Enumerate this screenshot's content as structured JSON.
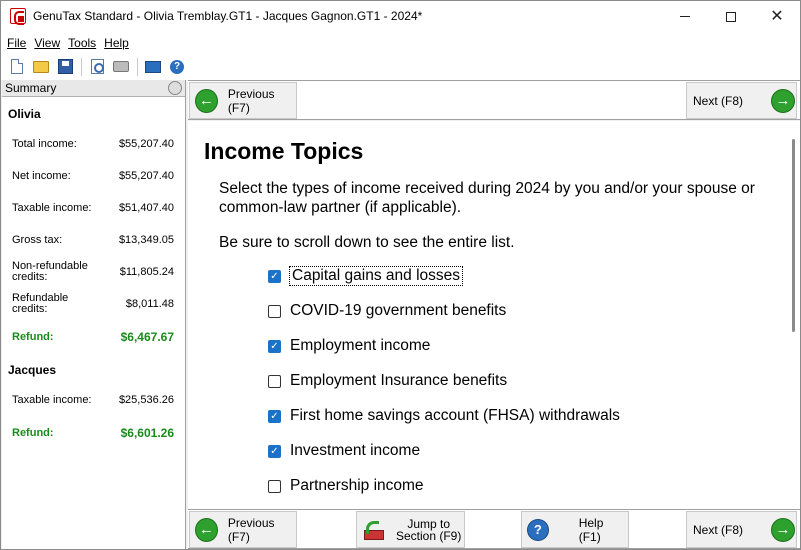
{
  "window": {
    "title": "GenuTax Standard - Olivia Tremblay.GT1 - Jacques Gagnon.GT1 - 2024*",
    "minimize": "—",
    "maximize": "☐",
    "close": "✕"
  },
  "menu": {
    "file": "File",
    "view": "View",
    "tools": "Tools",
    "help": "Help"
  },
  "toolbar": {
    "icons": [
      "new-file-icon",
      "open-folder-icon",
      "save-icon",
      "print-preview-icon",
      "print-icon",
      "calculator-icon",
      "help-icon"
    ]
  },
  "summary": {
    "header": "Summary",
    "persons": [
      {
        "name": "Olivia",
        "rows": [
          {
            "label": "Total income:",
            "value": "$55,207.40"
          },
          {
            "label": "Net income:",
            "value": "$55,207.40"
          },
          {
            "label": "Taxable income:",
            "value": "$51,407.40"
          },
          {
            "label": "Gross tax:",
            "value": "$13,349.05"
          },
          {
            "label": "Non-refundable credits:",
            "value": "$11,805.24"
          },
          {
            "label": "Refundable credits:",
            "value": "$8,011.48"
          }
        ],
        "refund_label": "Refund:",
        "refund_value": "$6,467.67"
      },
      {
        "name": "Jacques",
        "rows": [
          {
            "label": "Taxable income:",
            "value": "$25,536.26"
          }
        ],
        "refund_label": "Refund:",
        "refund_value": "$6,601.26"
      }
    ]
  },
  "nav_top": {
    "previous": "Previous (F7)",
    "next": "Next (F8)"
  },
  "nav_bottom": {
    "previous": "Previous (F7)",
    "jump_line1": "Jump to",
    "jump_line2": "Section (F9)",
    "help": "Help (F1)",
    "next": "Next (F8)"
  },
  "content": {
    "title": "Income Topics",
    "intro": "Select the types of income received during 2024 by you and/or your spouse or common-law partner (if applicable).",
    "scroll_note": "Be sure to scroll down to see the entire list.",
    "items": [
      {
        "label": "Capital gains and losses",
        "checked": true
      },
      {
        "label": "COVID-19 government benefits",
        "checked": false
      },
      {
        "label": "Employment income",
        "checked": true
      },
      {
        "label": "Employment Insurance benefits",
        "checked": false
      },
      {
        "label": "First home savings account (FHSA) withdrawals",
        "checked": true
      },
      {
        "label": "Investment income",
        "checked": true
      },
      {
        "label": "Partnership income",
        "checked": false
      }
    ]
  },
  "colors": {
    "refund_green": "#1a8a1a",
    "check_blue": "#1a73c8",
    "nav_green": "#2da02d"
  }
}
